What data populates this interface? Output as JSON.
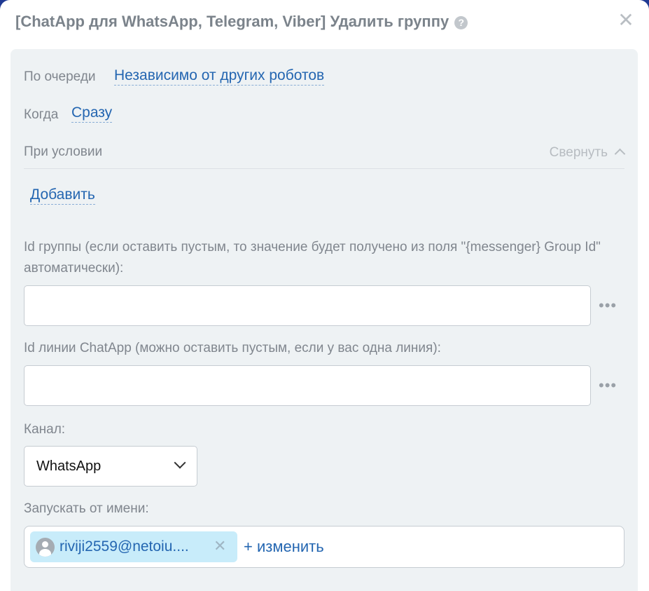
{
  "dialog": {
    "title": "[ChatApp для WhatsApp, Telegram, Viber] Удалить группу",
    "help_glyph": "?",
    "close_glyph": "✕"
  },
  "settings": {
    "queue_label": "По очереди",
    "queue_value": "Независимо от других роботов",
    "when_label": "Когда",
    "when_value": "Сразу",
    "condition_label": "При условии",
    "collapse_label": "Свернуть",
    "add_label": "Добавить"
  },
  "fields": {
    "group_id_label": "Id группы (если оставить пустым, то значение будет получено из поля \"{messenger} Group Id\" автоматически):",
    "group_id_value": "",
    "line_id_label": "Id линии ChatApp (можно оставить пустым, если у вас одна линия):",
    "line_id_value": "",
    "more_glyph": "•••",
    "channel_label": "Канал:",
    "channel_value": "WhatsApp",
    "run_as_label": "Запускать от имени:",
    "run_as_user": "riviji2559@netoiu....",
    "chip_remove_glyph": "✕",
    "change_label": "+ изменить"
  }
}
